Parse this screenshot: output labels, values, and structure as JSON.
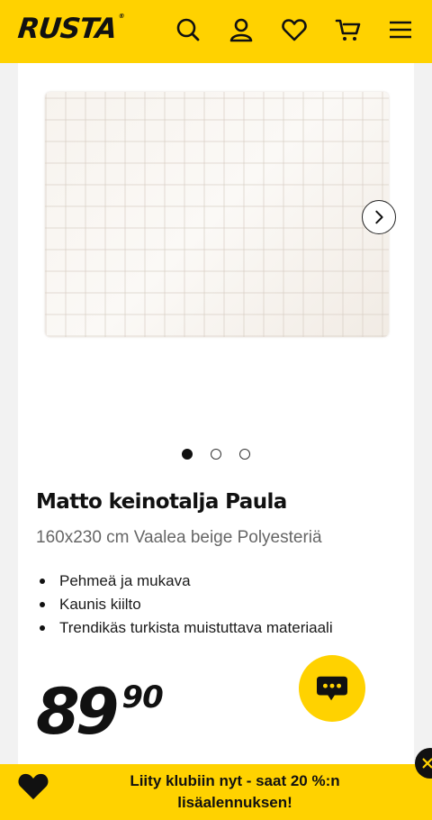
{
  "header": {
    "logo": "RUSTA",
    "logo_mark": "®",
    "icons": [
      "search-icon",
      "user-icon",
      "heart-icon",
      "cart-icon",
      "menu-icon"
    ]
  },
  "gallery": {
    "image": "product-rug-image",
    "slides_total": 3,
    "active_slide": 1
  },
  "product": {
    "title": "Matto keinotalja Paula",
    "subtitle": "160x230 cm Vaalea beige Polyesteriä",
    "features": [
      "Pehmeä ja mukava",
      "Kaunis kiilto",
      "Trendikäs turkista muistuttava materiaali"
    ],
    "price_main": "89",
    "price_cents": "90"
  },
  "promo": {
    "line1": "Liity klubiin nyt - saat 20 %:n",
    "line2": "lisäalennuksen!"
  },
  "colors": {
    "brand_yellow": "#ffd200",
    "text_dark": "#111111",
    "text_muted": "#666666"
  }
}
